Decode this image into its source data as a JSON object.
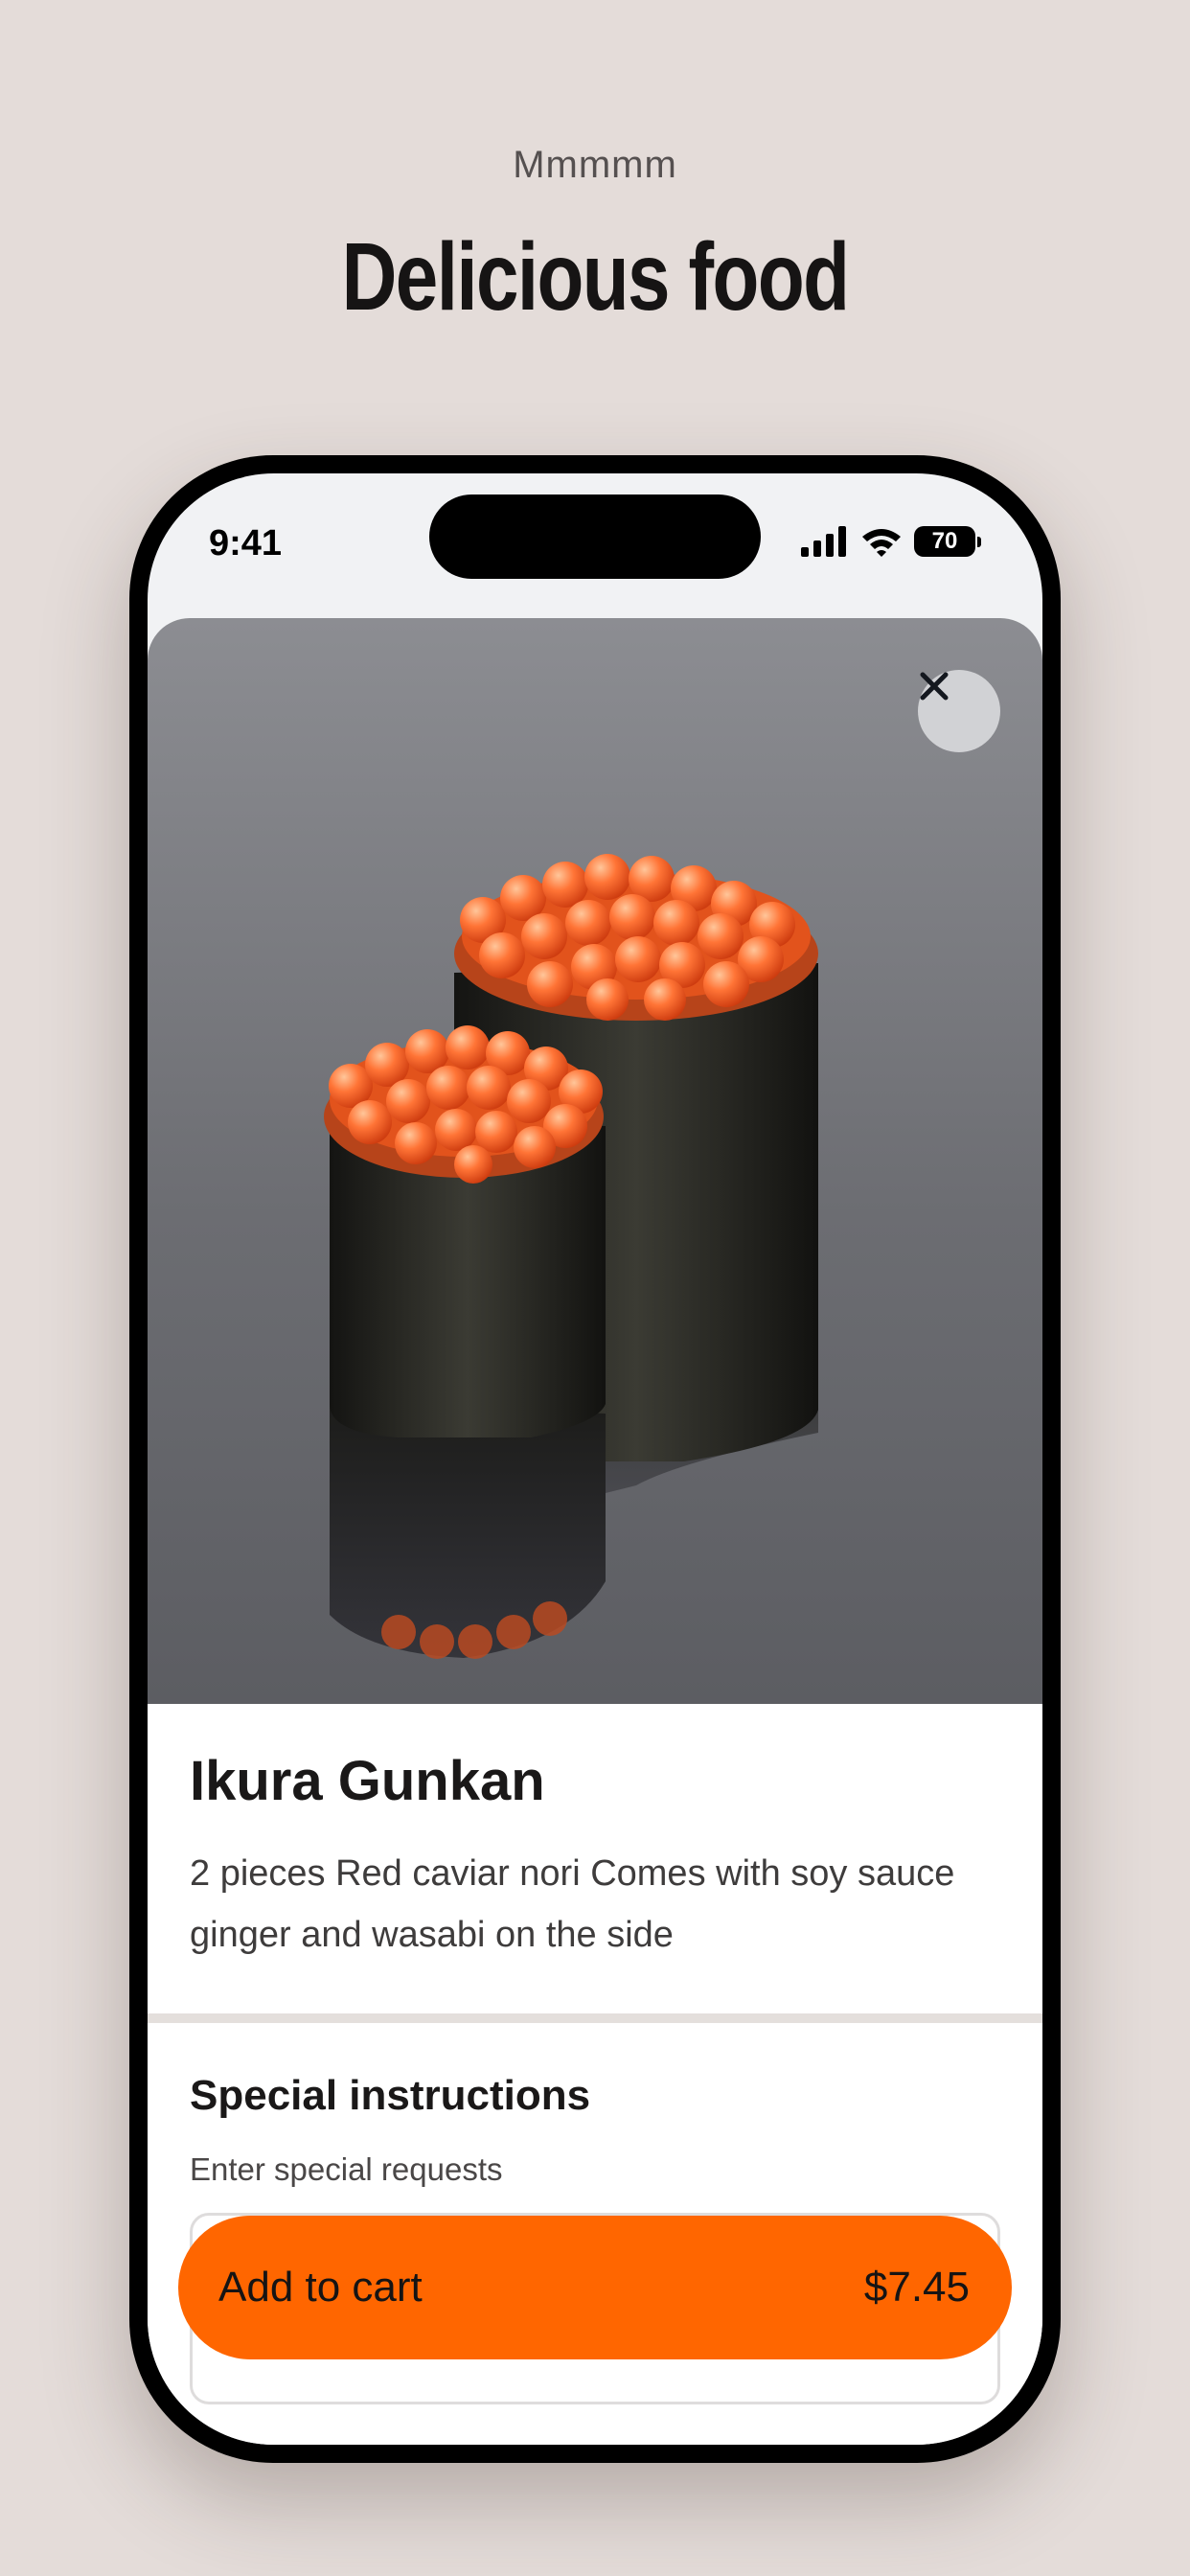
{
  "page": {
    "eyebrow": "Mmmmm",
    "heading": "Delicious food"
  },
  "status_bar": {
    "time": "9:41",
    "battery": "70"
  },
  "item": {
    "name": "Ikura Gunkan",
    "description": "2 pieces Red caviar nori Comes with soy sauce ginger and wasabi on the side"
  },
  "instructions": {
    "title": "Special instructions",
    "subtitle": "Enter special requests",
    "value": ""
  },
  "cart": {
    "label": "Add to cart",
    "price": "$7.45"
  },
  "colors": {
    "background": "#e4dcd9",
    "accent": "#ff6600",
    "caviar": "#ff6a2a",
    "nori": "#1c1c18"
  },
  "icons": {
    "close": "close-icon",
    "signal": "signal-icon",
    "wifi": "wifi-icon",
    "battery": "battery-icon"
  }
}
